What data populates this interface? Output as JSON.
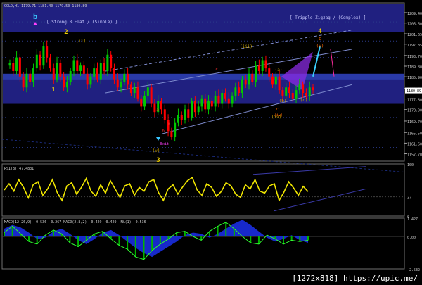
{
  "chart_data": [
    {
      "panel": "price",
      "type": "candlestick",
      "title": "GOLD,H1 1179.71 1181.40 1179.50 1180.89",
      "ylim": [
        1155.0,
        1213.0
      ],
      "y_ticks": [
        "1209.40",
        "1205.60",
        "1201.65",
        "1197.85",
        "1193.70",
        "1189.80",
        "1185.90",
        "1181.70",
        "1177.80",
        "1173.90",
        "1169.70",
        "1165.50",
        "1161.60",
        "1157.70"
      ],
      "last_price": "1180.89",
      "colors": {
        "bull": "#00c800",
        "bear": "#ff0000",
        "band": "#202080",
        "band_light": "#2a3aa8",
        "trend": "#7f8ccf"
      },
      "labels": [
        {
          "text": "b",
          "color": "#39c6ff"
        },
        {
          "text": "2",
          "color": "#f0d000"
        },
        {
          "text": "1",
          "color": "#f0d000"
        },
        {
          "text": "3",
          "color": "#f0d000"
        },
        {
          "text": "4",
          "color": "#f0d000"
        },
        {
          "text": "c",
          "color": "#ff6a00"
        },
        {
          "text": "(v)",
          "color": "#ff6a00"
        },
        {
          "text": "(iii)",
          "color": "#c8a000"
        },
        {
          "text": "(iv)",
          "color": "#c8a000"
        },
        {
          "text": "(ii)",
          "color": "#c8a000"
        },
        {
          "text": "(v)",
          "color": "#c8a000"
        },
        {
          "text": "a",
          "color": "#ff3030"
        },
        {
          "text": "b",
          "color": "#ff3030"
        },
        {
          "text": "c",
          "color": "#ff3030"
        },
        {
          "text": "x",
          "color": "#ff3030"
        },
        {
          "text": "(a)",
          "color": "#c8a000"
        },
        {
          "text": "(b)",
          "color": "#c8a000"
        },
        {
          "text": "(c)",
          "color": "#c8a000"
        },
        {
          "text": "c",
          "color": "#ff6a00"
        },
        {
          "text": "(iv)",
          "color": "#ff6a00"
        }
      ],
      "annotations": [
        "[ Strong B Flat / (Simple) ]",
        "[ Tripple Zigzag / (Complex) ]",
        "Exit"
      ],
      "series": [
        {
          "name": "close",
          "values": [
            1191,
            1188,
            1193,
            1186,
            1182,
            1187,
            1184,
            1189,
            1194,
            1190,
            1197,
            1193,
            1189,
            1185,
            1191,
            1186,
            1182,
            1184,
            1188,
            1192,
            1188,
            1190,
            1187,
            1183,
            1186,
            1189,
            1185,
            1191,
            1188,
            1194,
            1189,
            1185,
            1182,
            1184,
            1187,
            1183,
            1180,
            1182,
            1178,
            1175,
            1179,
            1182,
            1176,
            1173,
            1177,
            1174,
            1170,
            1166,
            1164,
            1169,
            1172,
            1170,
            1174,
            1171,
            1177,
            1173,
            1175,
            1178,
            1174,
            1177,
            1175,
            1179,
            1176,
            1180,
            1178,
            1176,
            1179,
            1182,
            1180,
            1185,
            1183,
            1187,
            1184,
            1190,
            1188,
            1192,
            1189,
            1186,
            1183,
            1186,
            1181,
            1179,
            1182,
            1180,
            1178,
            1181,
            1183,
            1180,
            1179,
            1182,
            1181
          ]
        }
      ]
    },
    {
      "panel": "rsi",
      "type": "line",
      "title": "RSI(8) 47.4831",
      "ylim": [
        0,
        100
      ],
      "y_ticks": [
        "100",
        "37",
        "0"
      ],
      "series": [
        {
          "name": "RSI(8)",
          "values": [
            50,
            62,
            48,
            70,
            55,
            35,
            60,
            66,
            40,
            52,
            70,
            45,
            30,
            58,
            64,
            42,
            55,
            72,
            48,
            38,
            60,
            44,
            68,
            52,
            36,
            58,
            62,
            40,
            55,
            48,
            66,
            70,
            45,
            30,
            52,
            60,
            42,
            56,
            68,
            74,
            50,
            40,
            62,
            55,
            38,
            47,
            64,
            58,
            42,
            36,
            60,
            52,
            70,
            48,
            44,
            58,
            62,
            30,
            46,
            66,
            54,
            40,
            57,
            47
          ]
        }
      ]
    },
    {
      "panel": "macd",
      "type": "area",
      "title": "MACD(12,26,9) -0.536 -0.267   MACD(2,8,2) -0.429 -0.429 -MA(1) -0.536",
      "ylim": [
        -2.532,
        1.427
      ],
      "y_ticks": [
        "1.427",
        "0.00",
        "-2.532"
      ],
      "series": [
        {
          "name": "MACD(12,26,9)",
          "values": [
            0.6,
            0.9,
            0.7,
            0.3,
            -0.2,
            -0.1,
            0.4,
            0.6,
            0.2,
            -0.3,
            -0.6,
            -0.2,
            0.3,
            0.5,
            0.1,
            -0.4,
            -0.9,
            -1.3,
            -1.6,
            -1.2,
            -0.8,
            -0.4,
            0.1,
            0.3,
            0.2,
            -0.1,
            0.2,
            0.6,
            1.0,
            1.3,
            0.9,
            0.4,
            -0.1,
            -0.4,
            -0.2,
            0.1,
            -0.3,
            -0.5
          ]
        },
        {
          "name": "MACD(2,8,2)",
          "values": [
            0.3,
            0.8,
            0.2,
            -0.4,
            -0.6,
            0.1,
            0.5,
            0.2,
            -0.5,
            -0.8,
            -0.3,
            0.2,
            0.4,
            -0.2,
            -0.7,
            -1.0,
            -1.6,
            -1.8,
            -1.1,
            -0.6,
            -0.2,
            0.3,
            0.4,
            0.0,
            -0.3,
            0.4,
            0.8,
            1.1,
            0.6,
            0.0,
            -0.5,
            -0.6,
            0.1,
            -0.2,
            -0.6,
            -0.3,
            -0.4,
            -0.3
          ]
        }
      ]
    }
  ],
  "footer": "[1272x818] https://upic.me/"
}
